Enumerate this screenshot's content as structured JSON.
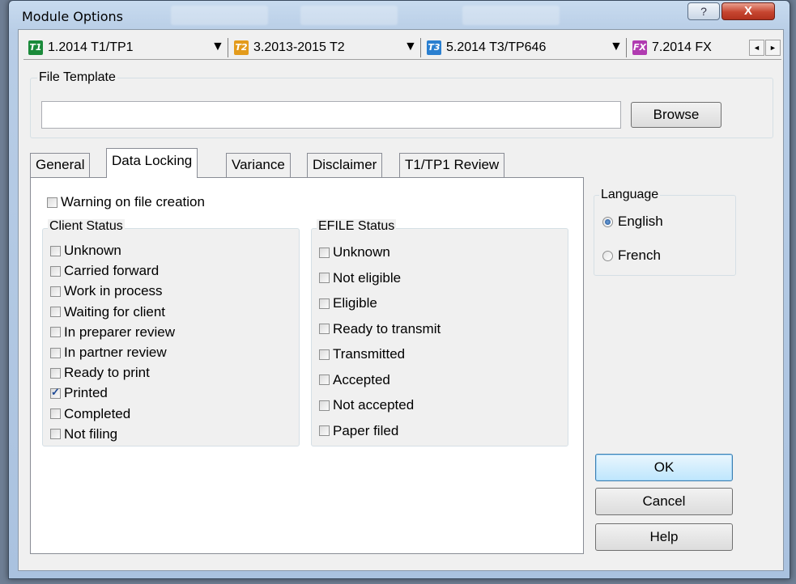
{
  "window": {
    "title": "Module Options",
    "help_label": "?",
    "close_label": "X"
  },
  "module_tabs": [
    {
      "icon": "T1",
      "color": "#1a8a3a",
      "label": "1.2014 T1/TP1"
    },
    {
      "icon": "T2",
      "color": "#e39b1c",
      "label": "3.2013-2015 T2"
    },
    {
      "icon": "T3",
      "color": "#2a7fd0",
      "label": "5.2014 T3/TP646"
    },
    {
      "icon": "FX",
      "color": "#b03bb0",
      "label": "7.2014 FX"
    }
  ],
  "dropdown_arrow": "▼",
  "scroll": {
    "left": "◄",
    "right": "►"
  },
  "file_template": {
    "label": "File Template",
    "value": "",
    "browse_label": "Browse"
  },
  "tabs": [
    "General",
    "Data Locking",
    "Variance",
    "Disclaimer",
    "T1/TP1 Review"
  ],
  "warning": {
    "label": "Warning on file creation",
    "checked": false
  },
  "client_status": {
    "label": "Client Status",
    "items": [
      {
        "label": "Unknown",
        "checked": false
      },
      {
        "label": "Carried forward",
        "checked": false
      },
      {
        "label": "Work in process",
        "checked": false
      },
      {
        "label": "Waiting for client",
        "checked": false
      },
      {
        "label": "In preparer review",
        "checked": false
      },
      {
        "label": "In partner review",
        "checked": false
      },
      {
        "label": "Ready to print",
        "checked": false
      },
      {
        "label": "Printed",
        "checked": true
      },
      {
        "label": "Completed",
        "checked": false
      },
      {
        "label": "Not filing",
        "checked": false
      }
    ]
  },
  "efile_status": {
    "label": "EFILE Status",
    "items": [
      {
        "label": "Unknown",
        "checked": false
      },
      {
        "label": "Not eligible",
        "checked": false
      },
      {
        "label": "Eligible",
        "checked": false
      },
      {
        "label": "Ready to transmit",
        "checked": false
      },
      {
        "label": "Transmitted",
        "checked": false
      },
      {
        "label": "Accepted",
        "checked": false
      },
      {
        "label": "Not accepted",
        "checked": false
      },
      {
        "label": "Paper filed",
        "checked": false
      }
    ]
  },
  "language": {
    "label": "Language",
    "options": [
      {
        "label": "English",
        "selected": true
      },
      {
        "label": "French",
        "selected": false
      }
    ]
  },
  "buttons": {
    "ok": "OK",
    "cancel": "Cancel",
    "help": "Help"
  }
}
